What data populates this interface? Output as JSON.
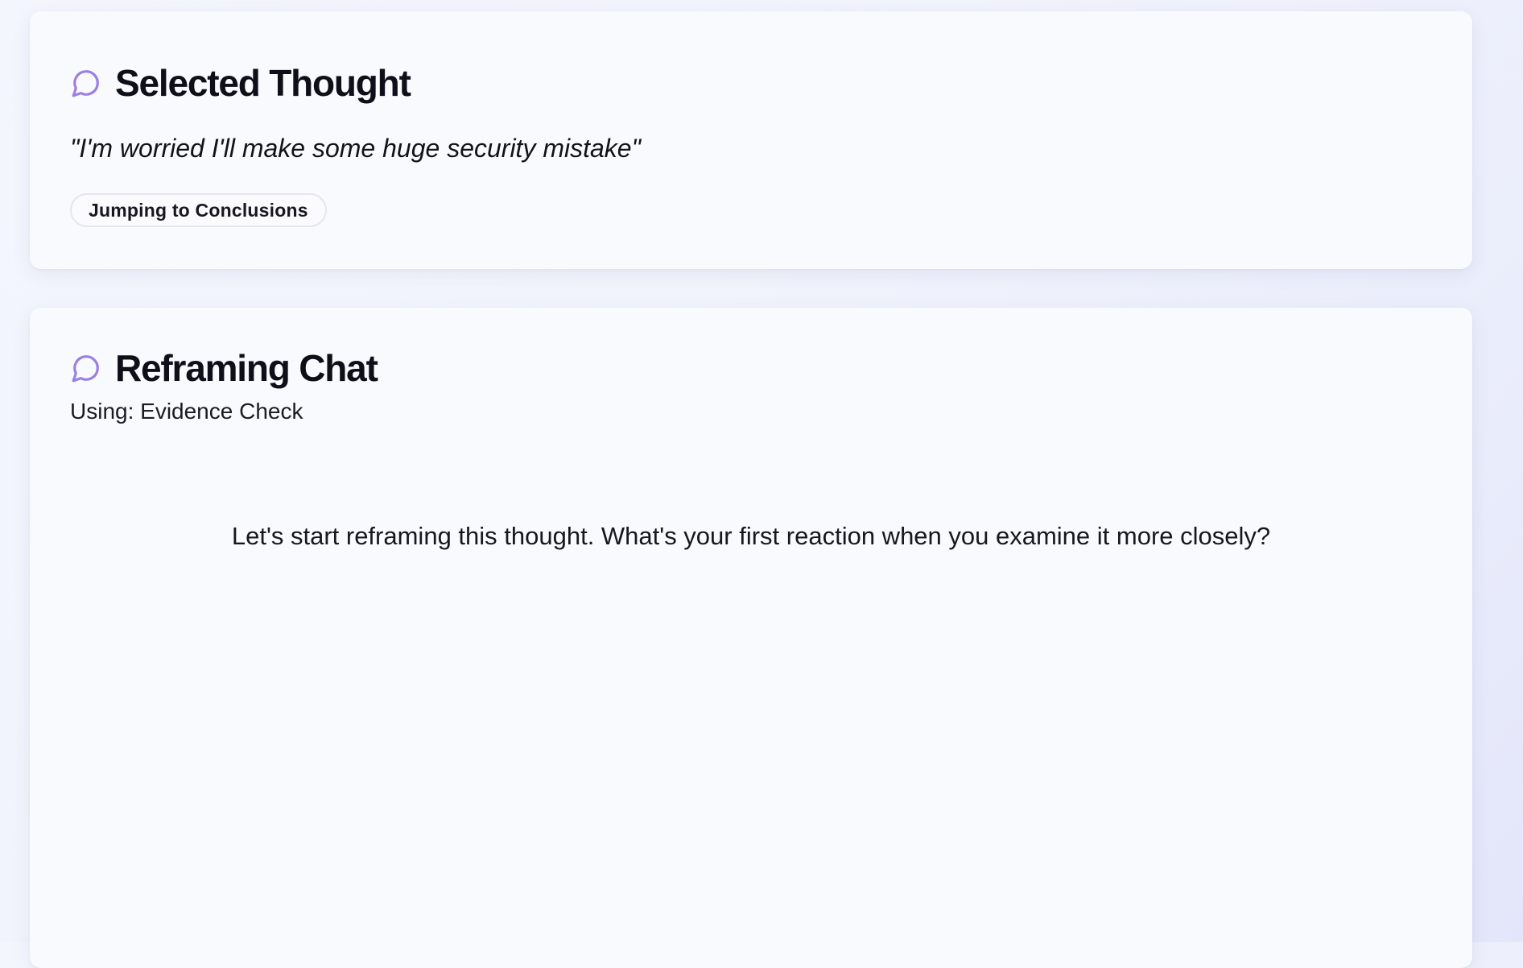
{
  "selected_thought": {
    "title": "Selected Thought",
    "icon": "chat-bubble-icon",
    "thought_text": "\"I'm worried I'll make some huge security mistake\"",
    "distortion_tag": "Jumping to Conclusions"
  },
  "reframing_chat": {
    "title": "Reframing Chat",
    "icon": "chat-bubble-icon",
    "using_label": "Using: Evidence Check",
    "messages": [
      "Let's start reframing this thought. What's your first reaction when you examine it more closely?"
    ]
  },
  "colors": {
    "accent": "#9b7fe6",
    "card_background": "#f9fafe",
    "page_background": "#eef1fc",
    "text": "#0f0f1a"
  }
}
